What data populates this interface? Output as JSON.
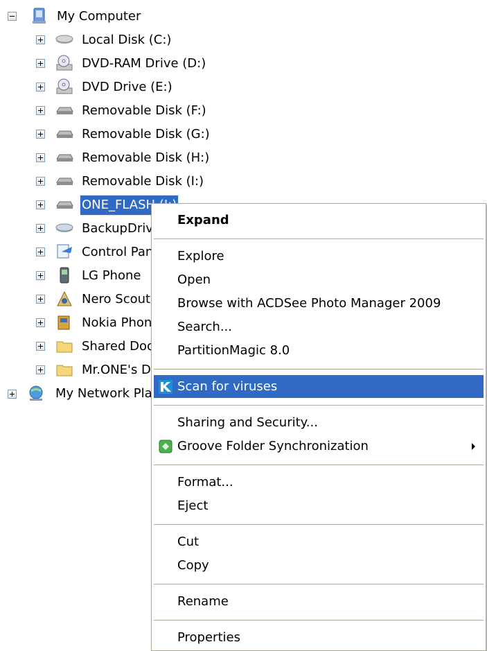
{
  "tree": {
    "root": {
      "label": "My Computer",
      "icon": "computer-icon"
    },
    "drives": [
      {
        "label": "Local Disk (C:)",
        "icon": "hard-disk-icon"
      },
      {
        "label": "DVD-RAM Drive (D:)",
        "icon": "dvd-drive-icon"
      },
      {
        "label": "DVD Drive (E:)",
        "icon": "dvd-drive-icon"
      },
      {
        "label": "Removable Disk (F:)",
        "icon": "removable-disk-icon"
      },
      {
        "label": "Removable Disk (G:)",
        "icon": "removable-disk-icon"
      },
      {
        "label": "Removable Disk (H:)",
        "icon": "removable-disk-icon"
      },
      {
        "label": "Removable Disk (I:)",
        "icon": "removable-disk-icon"
      },
      {
        "label": "ONE_FLASH (J:)",
        "icon": "removable-disk-icon",
        "selected": true
      },
      {
        "label": "BackupDrive",
        "icon": "network-drive-icon"
      },
      {
        "label": "Control Panel",
        "icon": "control-panel-icon"
      },
      {
        "label": "LG Phone",
        "icon": "phone-icon"
      },
      {
        "label": "Nero Scout",
        "icon": "nero-scout-icon"
      },
      {
        "label": "Nokia Phone Browser",
        "icon": "nokia-phone-icon"
      },
      {
        "label": "Shared Documents",
        "icon": "folder-icon"
      },
      {
        "label": "Mr.ONE's Documents",
        "icon": "folder-icon"
      }
    ],
    "network": {
      "label": "My Network Places",
      "icon": "network-places-icon"
    }
  },
  "context_menu": {
    "expand": "Expand",
    "explore": "Explore",
    "open": "Open",
    "browse_acdsee": "Browse with ACDSee Photo Manager 2009",
    "search": "Search...",
    "partition_magic": "PartitionMagic 8.0",
    "scan_viruses": "Scan for viruses",
    "sharing_security": "Sharing and Security...",
    "groove_sync": "Groove Folder Synchronization",
    "format": "Format...",
    "eject": "Eject",
    "cut": "Cut",
    "copy": "Copy",
    "rename": "Rename",
    "properties": "Properties"
  },
  "colors": {
    "selection": "#316ac5",
    "menu_border": "#aca899"
  }
}
